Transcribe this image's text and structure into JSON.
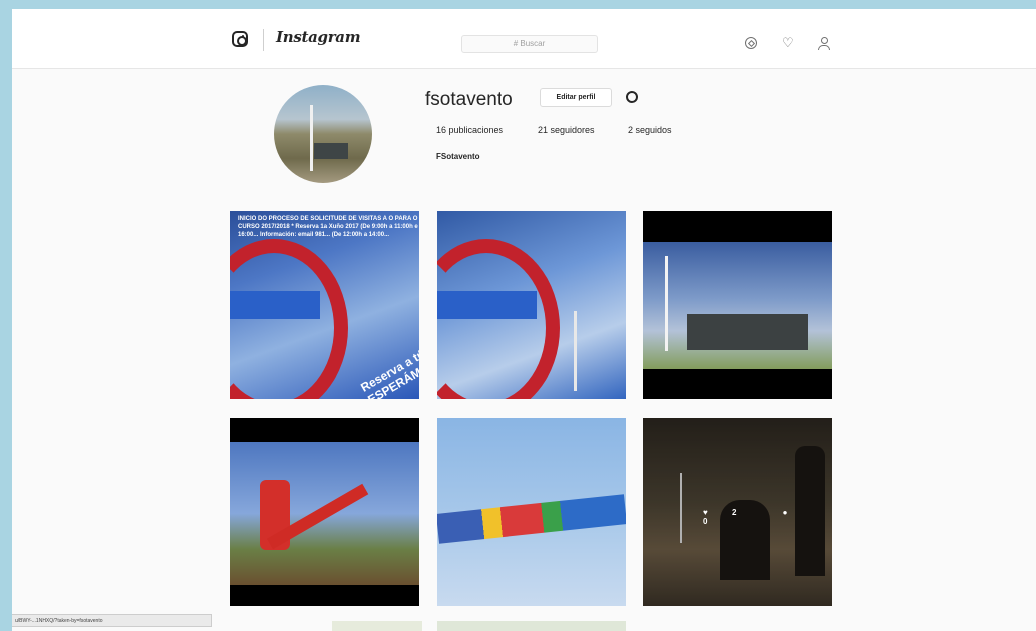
{
  "header": {
    "brand": "Instagram",
    "search_placeholder": "# Buscar",
    "icons": [
      "instagram-logo-icon",
      "compass-icon",
      "heart-icon",
      "user-icon"
    ]
  },
  "profile": {
    "username": "fsotavento",
    "edit_button": "Editar perfil",
    "stats": {
      "posts": "16 publicaciones",
      "followers": "21 seguidores",
      "following": "2 seguidos"
    },
    "full_name": "FSotavento"
  },
  "posts": [
    {
      "id": "post-1",
      "overlay_text": "INICIO DO PROCESO DE SOLICITUDE DE VISITAS A O PARA O CURSO 2017/2018 *  Reserva 1a Xuño 2017 (De 9:00h a 11:00h e 16:00...  Información: email 981... (De 12:00h a 14:00...",
      "banner_text": "Reserva a túa ESPERÁMO..."
    },
    {
      "id": "post-2"
    },
    {
      "id": "post-3"
    },
    {
      "id": "post-4"
    },
    {
      "id": "post-5"
    },
    {
      "id": "post-6",
      "likes": "2",
      "comments": "0"
    }
  ],
  "status_url": "u/BWY-...1NHXQ/?taken-by=fsotavento",
  "colors": {
    "background": "#fafafa",
    "frame": "#a9d4e2",
    "text": "#262626"
  }
}
